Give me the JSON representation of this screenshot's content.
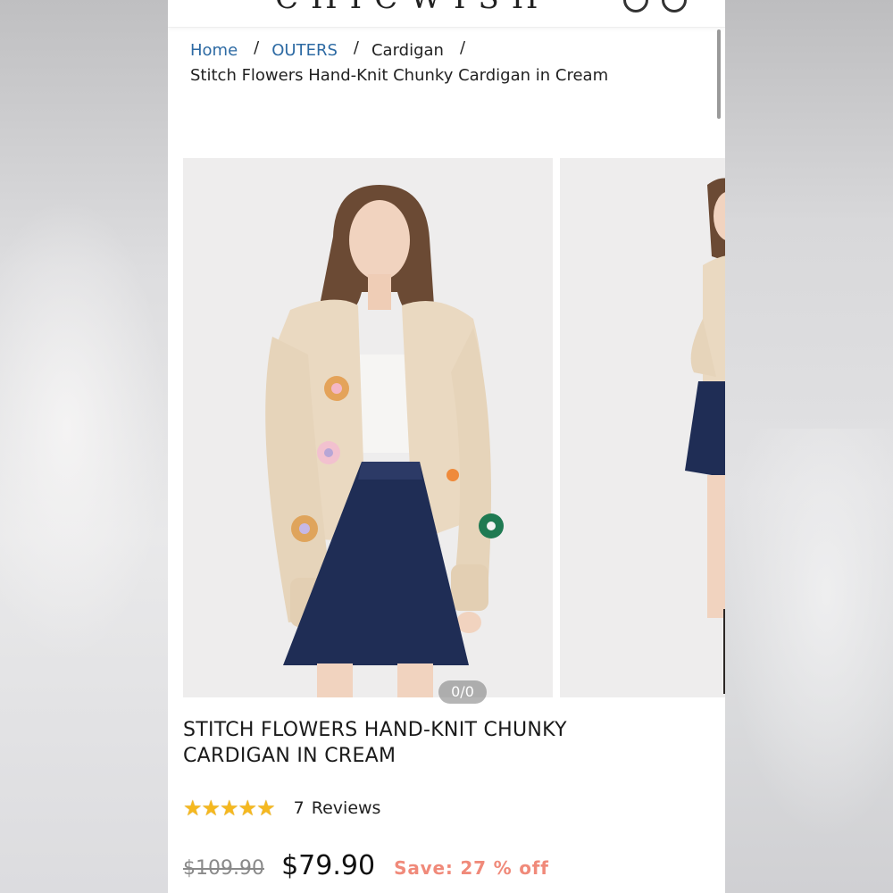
{
  "header": {
    "brand": "CHICWISH"
  },
  "breadcrumb": {
    "items": [
      "Home",
      "OUTERS",
      "Cardigan"
    ],
    "separator": "/",
    "current": "Stitch Flowers Hand-Knit Chunky Cardigan in Cream"
  },
  "gallery": {
    "counter": "0/0",
    "images": [
      "model-front-image",
      "model-side-image"
    ]
  },
  "product": {
    "title_line1": "STITCH FLOWERS HAND-KNIT CHUNKY",
    "title_line2": "CARDIGAN IN CREAM",
    "rating": 5,
    "rating_max": 5,
    "review_count": "7",
    "review_label": "Reviews",
    "original_price": "$109.90",
    "sale_price": "$79.90",
    "save_text": "Save: 27 % off"
  },
  "colors": {
    "link": "#2d6aa3",
    "star": "#f5b81f",
    "save": "#f08a7a"
  }
}
